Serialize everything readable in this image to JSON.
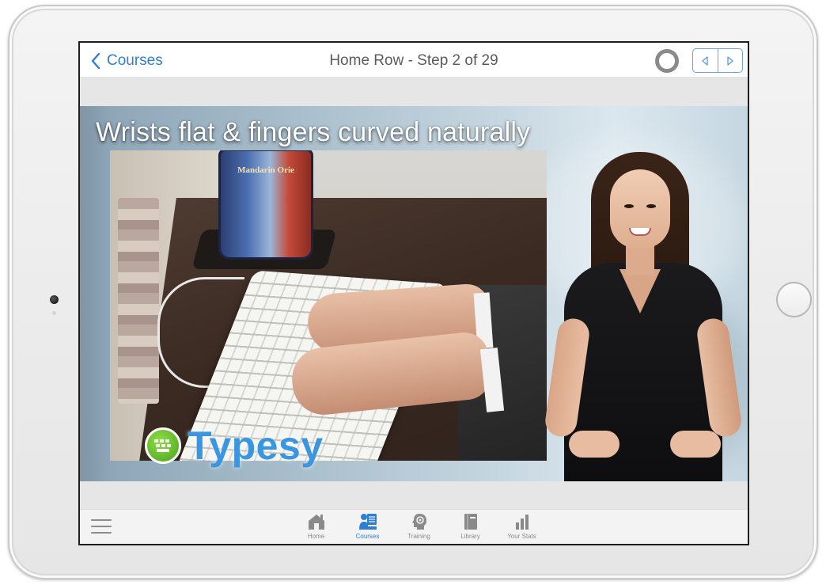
{
  "navbar": {
    "back_label": "Courses",
    "title": "Home Row - Step 2 of 29"
  },
  "video": {
    "title": "Wrists flat & fingers curved naturally",
    "mug_text": "Mandarin Orie",
    "brand": "Typesy"
  },
  "tabbar": {
    "tabs": [
      {
        "label": "Home",
        "icon": "home-icon",
        "active": false
      },
      {
        "label": "Courses",
        "icon": "courses-icon",
        "active": true
      },
      {
        "label": "Training",
        "icon": "training-icon",
        "active": false
      },
      {
        "label": "Library",
        "icon": "library-icon",
        "active": false
      },
      {
        "label": "Your Stats",
        "icon": "stats-icon",
        "active": false
      }
    ]
  },
  "colors": {
    "accent": "#2f7fd0",
    "inactive": "#8a8a8a",
    "typesy_blue": "#3a96e0",
    "typesy_green": "#5cb82a"
  }
}
